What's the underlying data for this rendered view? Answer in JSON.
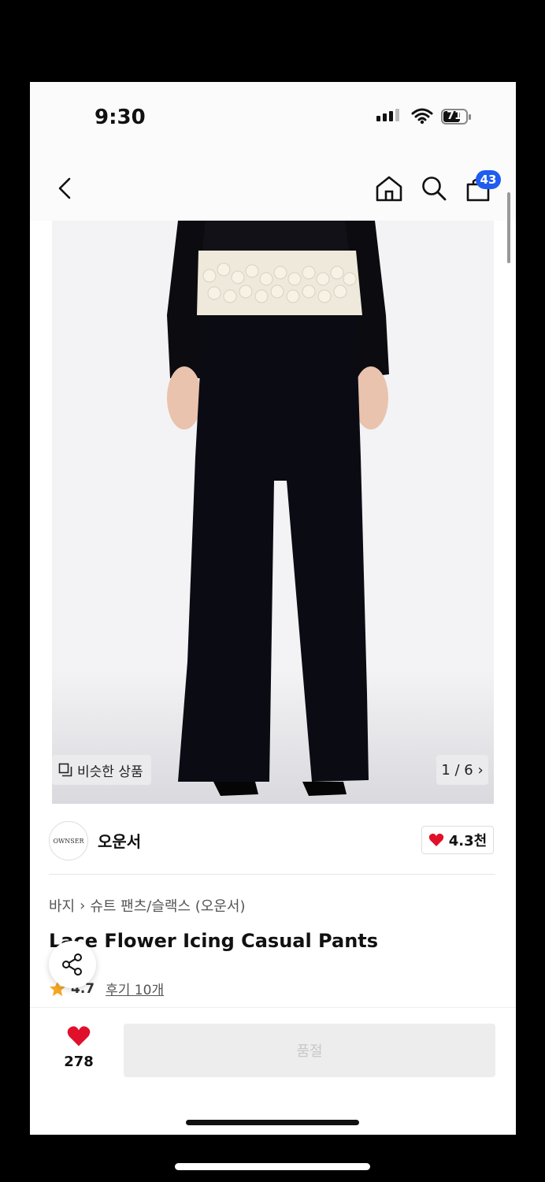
{
  "status_bar": {
    "time": "9:30",
    "battery": "71"
  },
  "nav": {
    "cart_count": "43"
  },
  "image": {
    "similar_label": "비슷한 상품",
    "pager": "1 / 6 ›"
  },
  "brand": {
    "logo_text": "OWNSER",
    "name": "오운서",
    "likes": "4.3천"
  },
  "breadcrumb": {
    "category": "바지",
    "sub": "슈트 팬츠/슬랙스 (오운서)"
  },
  "product": {
    "title": "Lace Flower Icing Casual Pants",
    "rating": "4.7",
    "reviews": "후기 10개"
  },
  "bottom": {
    "wish_count": "278",
    "buy_label": "품절"
  },
  "colors": {
    "accent_blue": "#1f5cf0",
    "heart_red": "#e0102a",
    "star": "#f5a623"
  }
}
